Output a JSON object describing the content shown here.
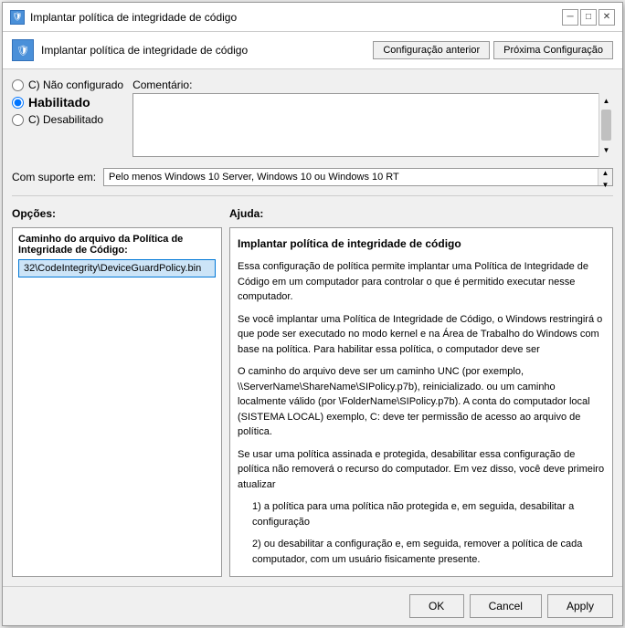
{
  "window": {
    "title": "Implantar política de integridade de código",
    "icon": "🛡"
  },
  "header": {
    "icon": "🛡",
    "title": "Implantar política de integridade de código",
    "btn_prev": "Configuração anterior",
    "btn_next": "Próxima Configuração"
  },
  "radio": {
    "not_configured": "C) Não configurado",
    "enabled": "Habilitado",
    "disabled": "C) Desabilitado"
  },
  "comment": {
    "label": "Comentário:"
  },
  "support": {
    "label": "Com suporte em:",
    "value": "Pelo menos Windows 10 Server, Windows 10 ou Windows 10 RT"
  },
  "options": {
    "label": "Opções:",
    "desc": "Caminho do arquivo da Política de Integridade de Código:",
    "value": "32\\CodeIntegrity\\DeviceGuardPolicy.bin"
  },
  "help": {
    "label": "Ajuda:",
    "title": "Implantar política de integridade de código",
    "paragraphs": [
      "Essa configuração de política permite implantar uma Política de Integridade de Código em um computador para controlar o que é permitido executar nesse computador.",
      "Se você implantar uma Política de Integridade de Código, o Windows restringirá o que pode ser executado no modo kernel e na Área de Trabalho do Windows com base na política. Para habilitar essa política, o computador deve ser",
      "O caminho do arquivo deve ser um caminho UNC (por exemplo, \\\\ServerName\\ShareName\\SIPolicy.p7b), reinicializado. ou um caminho localmente válido (por \\FolderName\\SIPolicy.p7b). A conta do computador local (SISTEMA LOCAL) exemplo, C: deve ter permissão de acesso ao arquivo de política.",
      "Se usar uma política assinada e protegida, desabilitar essa configuração de política não removerá o recurso do computador. Em vez disso, você deve primeiro atualizar",
      "1) a política para uma política não protegida e, em seguida, desabilitar a configuração",
      "2) ou desabilitar a configuração e, em seguida, remover a política de cada computador, com um usuário fisicamente presente."
    ]
  },
  "footer": {
    "ok": "OK",
    "cancel": "Cancel",
    "apply": "Apply"
  }
}
